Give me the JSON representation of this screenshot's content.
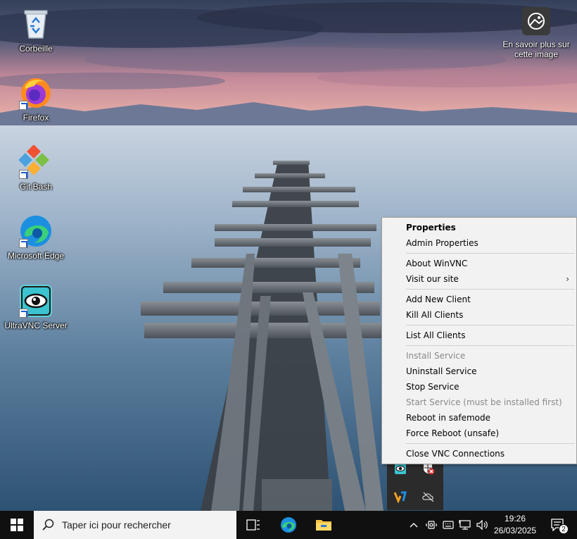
{
  "desktop": {
    "icons": [
      {
        "label": "Corbeille",
        "icon": "recycle-bin-icon"
      },
      {
        "label": "Firefox",
        "icon": "firefox-icon"
      },
      {
        "label": "Git Bash",
        "icon": "git-bash-icon"
      },
      {
        "label": "Microsoft Edge",
        "icon": "edge-icon"
      },
      {
        "label": "UltraVNC Server",
        "icon": "ultravnc-icon"
      }
    ],
    "learn_more_label": "En savoir plus sur cette image"
  },
  "context_menu": {
    "items": [
      {
        "label": "Properties",
        "style": "bold"
      },
      {
        "label": "Admin Properties"
      },
      {
        "label": "About WinVNC"
      },
      {
        "label": "Visit our site",
        "submenu_arrow": "›"
      },
      {
        "label": "Add New Client"
      },
      {
        "label": "Kill All Clients"
      },
      {
        "label": "List All Clients"
      },
      {
        "label": "Install Service",
        "state": "disabled"
      },
      {
        "label": "Uninstall Service"
      },
      {
        "label": "Stop Service"
      },
      {
        "label": "Start Service (must be installed first)",
        "state": "disabled"
      },
      {
        "label": "Reboot in safemode"
      },
      {
        "label": "Force Reboot (unsafe)"
      },
      {
        "label": "Close VNC Connections"
      }
    ]
  },
  "taskbar": {
    "search_placeholder": "Taper ici pour rechercher",
    "clock_time": "19:26",
    "clock_date": "26/03/2025",
    "notification_count": "2"
  },
  "colors": {
    "taskbar_bg": "#101010",
    "menu_bg": "#f2f2f2",
    "menu_disabled_text": "#8a8a8a"
  }
}
